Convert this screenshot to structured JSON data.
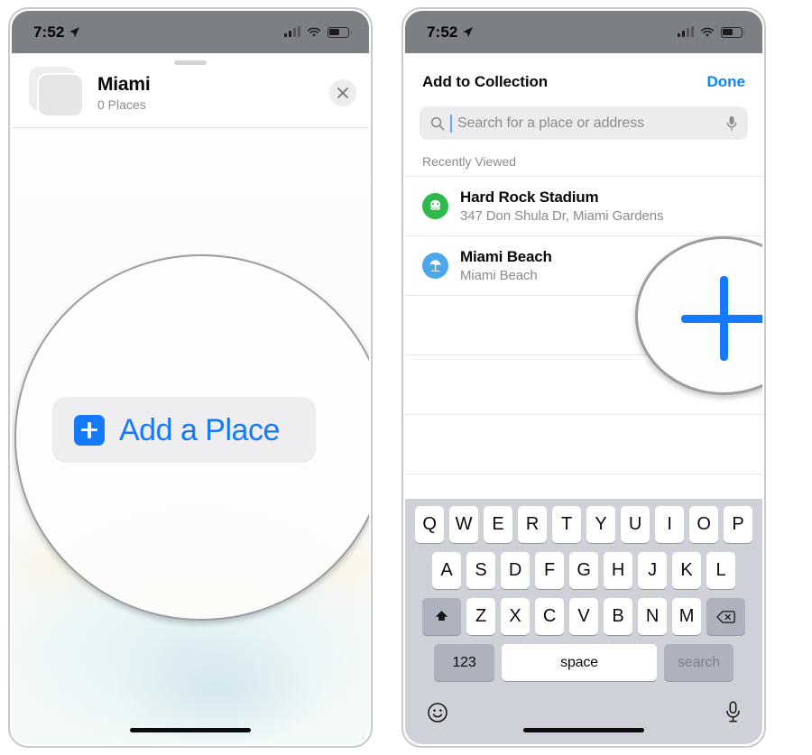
{
  "status_bar": {
    "time": "7:52",
    "location_arrow_icon": "location-arrow-icon",
    "cellular_icon": "signal-bars-icon",
    "wifi_icon": "wifi-icon",
    "battery_icon": "battery-icon",
    "battery_level_percent": 50,
    "background_color": "#7c8085"
  },
  "left_phone": {
    "collection_sheet": {
      "title": "Miami",
      "subtitle": "0 Places",
      "close_icon": "close-x-icon",
      "thumbnail_icon": "collection-thumbnail-stack-icon",
      "grabber_icon": "sheet-grabber-icon"
    },
    "callout": {
      "add_place_label": "Add a Place",
      "plus_icon": "plus-square-icon",
      "accent_color": "#1479ff"
    },
    "home_indicator_icon": "home-indicator"
  },
  "right_phone": {
    "header": {
      "title": "Add to Collection",
      "done_label": "Done",
      "done_color": "#0a84ff"
    },
    "search": {
      "placeholder": "Search for a place or address",
      "value": "",
      "search_icon": "search-magnifier-icon",
      "mic_icon": "microphone-icon",
      "caret_visible": true
    },
    "section_label": "Recently Viewed",
    "results": [
      {
        "title": "Hard Rock Stadium",
        "subtitle": "347 Don Shula Dr, Miami Gardens",
        "icon": "stadium-helmet-icon",
        "icon_color": "#2fb84c"
      },
      {
        "title": "Miami Beach",
        "subtitle": "Miami Beach",
        "icon": "beach-umbrella-icon",
        "icon_color": "#4ba7e8"
      }
    ],
    "empty_row_count": 4,
    "callout": {
      "plus_icon": "large-plus-icon",
      "accent_color": "#1479ff"
    },
    "keyboard": {
      "row1": [
        "Q",
        "W",
        "E",
        "R",
        "T",
        "Y",
        "U",
        "I",
        "O",
        "P"
      ],
      "row2": [
        "A",
        "S",
        "D",
        "F",
        "G",
        "H",
        "J",
        "K",
        "L"
      ],
      "row3": [
        "Z",
        "X",
        "C",
        "V",
        "B",
        "N",
        "M"
      ],
      "shift_icon": "shift-arrow-icon",
      "backspace_icon": "backspace-delete-icon",
      "numbers_label": "123",
      "space_label": "space",
      "return_label": "search",
      "emoji_icon": "emoji-smiley-icon",
      "dictation_icon": "microphone-icon"
    },
    "home_indicator_icon": "home-indicator"
  }
}
